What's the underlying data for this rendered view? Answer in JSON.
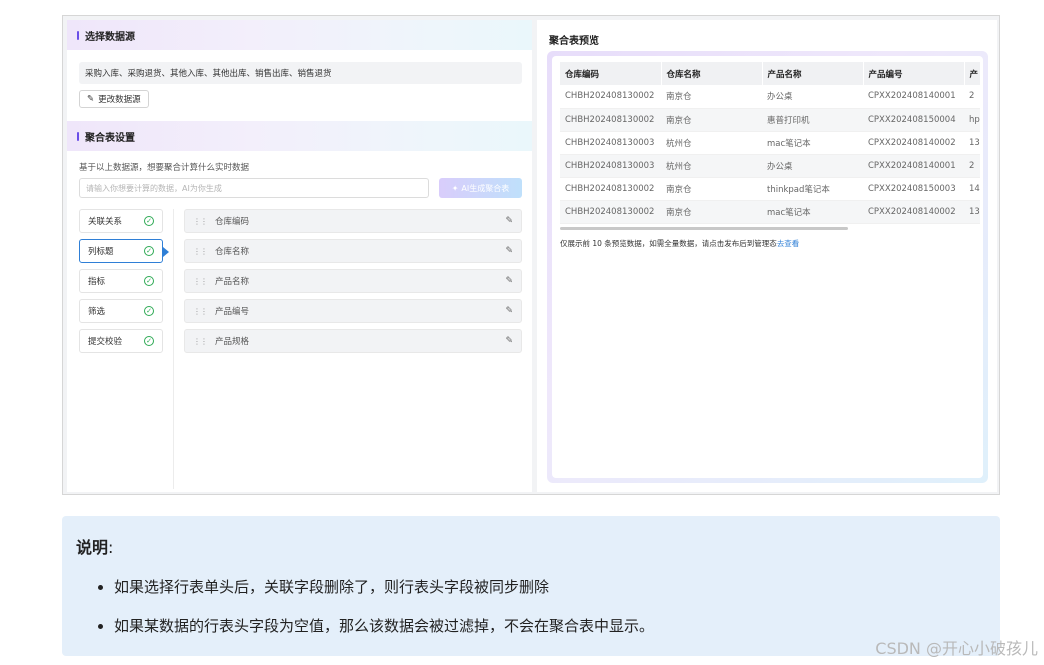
{
  "left": {
    "section1_title": "选择数据源",
    "source_text": "采购入库、采购退货、其他入库、其他出库、销售出库、销售退货",
    "edit_source_label": "更改数据源",
    "section2_title": "聚合表设置",
    "hint": "基于以上数据源，想要聚合计算什么实时数据",
    "ai_input_placeholder": "请输入你想要计算的数据，AI为你生成",
    "ai_button_label": "AI生成聚合表",
    "steps": [
      {
        "label": "关联关系"
      },
      {
        "label": "列标题"
      },
      {
        "label": "指标"
      },
      {
        "label": "筛选"
      },
      {
        "label": "提交校验"
      }
    ],
    "fields": [
      {
        "label": "仓库编码"
      },
      {
        "label": "仓库名称"
      },
      {
        "label": "产品名称"
      },
      {
        "label": "产品编号"
      },
      {
        "label": "产品规格"
      }
    ]
  },
  "preview": {
    "title": "聚合表预览",
    "columns": [
      "仓库编码",
      "仓库名称",
      "产品名称",
      "产品编号",
      "产"
    ],
    "rows": [
      [
        "CHBH202408130002",
        "南京仓",
        "办公桌",
        "CPXX202408140001",
        "2"
      ],
      [
        "CHBH202408130002",
        "南京仓",
        "惠普打印机",
        "CPXX202408150004",
        "hp"
      ],
      [
        "CHBH202408130003",
        "杭州仓",
        "mac笔记本",
        "CPXX202408140002",
        "13"
      ],
      [
        "CHBH202408130003",
        "杭州仓",
        "办公桌",
        "CPXX202408140001",
        "2"
      ],
      [
        "CHBH202408130002",
        "南京仓",
        "thinkpad笔记本",
        "CPXX202408150003",
        "14"
      ],
      [
        "CHBH202408130002",
        "南京仓",
        "mac笔记本",
        "CPXX202408140002",
        "13"
      ]
    ],
    "note": "仅展示前 10 条预览数据，如需全量数据，请点击发布后到管理态",
    "note_link": "去查看"
  },
  "desc": {
    "title": "说明",
    "title_colon": ":",
    "items": [
      "如果选择行表单头后，关联字段删除了，则行表头字段被同步删除",
      "如果某数据的行表头字段为空值，那么该数据会被过滤掉，不会在聚合表中显示。"
    ]
  },
  "watermark": "CSDN @开心小破孩儿",
  "colors": {
    "accent": "#6a4ee8",
    "active_border": "#2f7fd6",
    "check": "#2faa55",
    "desc_bg": "#e4effa"
  }
}
